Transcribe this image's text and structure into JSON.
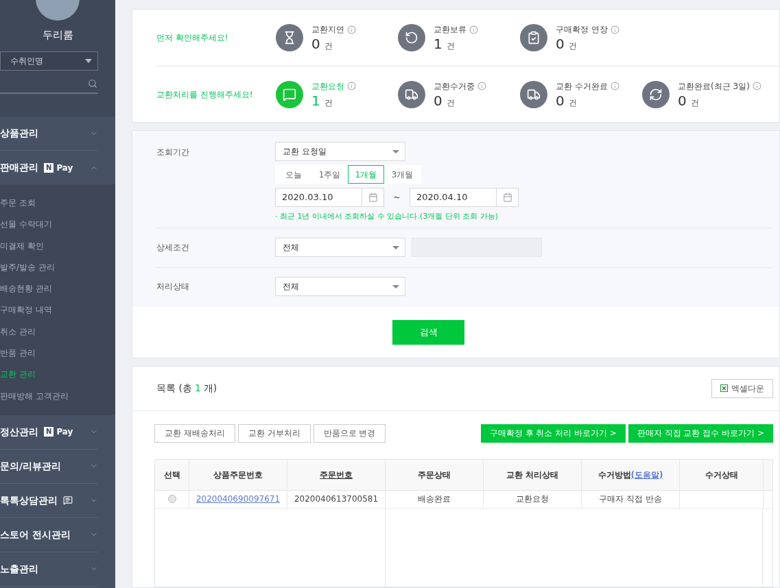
{
  "sidebar": {
    "profile": {
      "name": "두리룸"
    },
    "search_type": {
      "value": "수취인명"
    },
    "menu": [
      {
        "label": "상품관리",
        "expanded": false
      },
      {
        "label": "판매관리",
        "badge": {
          "kind": "npay",
          "letter": "N",
          "text": "Pay"
        },
        "expanded": true,
        "children": [
          {
            "label": "주문 조회",
            "selected": false
          },
          {
            "label": "선물 수락대기",
            "selected": false
          },
          {
            "label": "미결제 확인",
            "selected": false
          },
          {
            "label": "발주/발송 관리",
            "selected": false
          },
          {
            "label": "배송현황 관리",
            "selected": false
          },
          {
            "label": "구매확정 내역",
            "selected": false
          },
          {
            "label": "취소 관리",
            "selected": false
          },
          {
            "label": "반품 관리",
            "selected": false
          },
          {
            "label": "교환 관리",
            "selected": true
          },
          {
            "label": "판매방해 고객관리",
            "selected": false
          }
        ]
      },
      {
        "label": "정산관리",
        "badge": {
          "kind": "npay",
          "letter": "N",
          "text": "Pay"
        },
        "expanded": false
      },
      {
        "label": "문의/리뷰관리",
        "expanded": false
      },
      {
        "label": "톡톡상담관리",
        "badge": {
          "kind": "talk"
        },
        "expanded": false
      },
      {
        "label": "스토어 전시관리",
        "expanded": false
      },
      {
        "label": "노출관리",
        "expanded": false
      }
    ]
  },
  "summary": [
    {
      "heading": "먼저 확인해주세요!",
      "stats": [
        {
          "label": "교환지연",
          "count": "0",
          "unit": "건",
          "highlighted": false
        },
        {
          "label": "교환보류",
          "count": "1",
          "unit": "건",
          "highlighted": false
        },
        {
          "label": "구매확정 연장",
          "count": "0",
          "unit": "건",
          "highlighted": false
        }
      ]
    },
    {
      "heading": "교환처리를 진행해주세요!",
      "stats": [
        {
          "label": "교환요청",
          "count": "1",
          "unit": "건",
          "highlighted": true
        },
        {
          "label": "교환수거중",
          "count": "0",
          "unit": "건",
          "highlighted": false
        },
        {
          "label": "교환 수거완료",
          "count": "0",
          "unit": "건",
          "highlighted": false
        },
        {
          "label": "교환완료(최근 3일)",
          "count": "0",
          "unit": "건",
          "highlighted": false
        }
      ]
    }
  ],
  "filter": {
    "period": {
      "label": "조회기간",
      "select": "교환 요청일",
      "ranges": [
        {
          "label": "오늘",
          "selected": false
        },
        {
          "label": "1주일",
          "selected": false
        },
        {
          "label": "1개월",
          "selected": true
        },
        {
          "label": "3개월",
          "selected": false
        }
      ],
      "from": "2020.03.10",
      "separator": "~",
      "to": "2020.04.10",
      "note": "· 최근 1년 이내에서 조회하실 수 있습니다.(3개월 단위 조회 가능)"
    },
    "detail": {
      "label": "상세조건",
      "select": "전체"
    },
    "status": {
      "label": "처리상태",
      "select": "전체"
    },
    "search_button": "검색"
  },
  "list": {
    "title": "목록 (총",
    "count": "1",
    "title_suffix": "개)",
    "excel_button": "엑셀다운",
    "left_buttons": [
      "교환 재배송처리",
      "교환 거부처리",
      "반품으로 변경"
    ],
    "right_buttons": [
      "구매확정 후 취소 처리 바로가기 >",
      "판매자 직접 교환 접수 바로가기 >"
    ],
    "columns": [
      {
        "label": "선택",
        "underlined": false
      },
      {
        "label": "상품주문번호",
        "underlined": false
      },
      {
        "label": "주문번호",
        "underlined": true
      },
      {
        "label": "주문상태",
        "underlined": false
      },
      {
        "label": "교환 처리상태",
        "underlined": false
      },
      {
        "label": "수거방법",
        "link": "(도움말)",
        "underlined": false
      },
      {
        "label": "수거상태",
        "underlined": false
      }
    ],
    "rows": [
      {
        "selected": false,
        "cells": [
          "",
          "2020040690097671",
          "2020040613700581",
          "배송완료",
          "교환요청",
          "구매자 직접 반송",
          ""
        ]
      }
    ]
  }
}
